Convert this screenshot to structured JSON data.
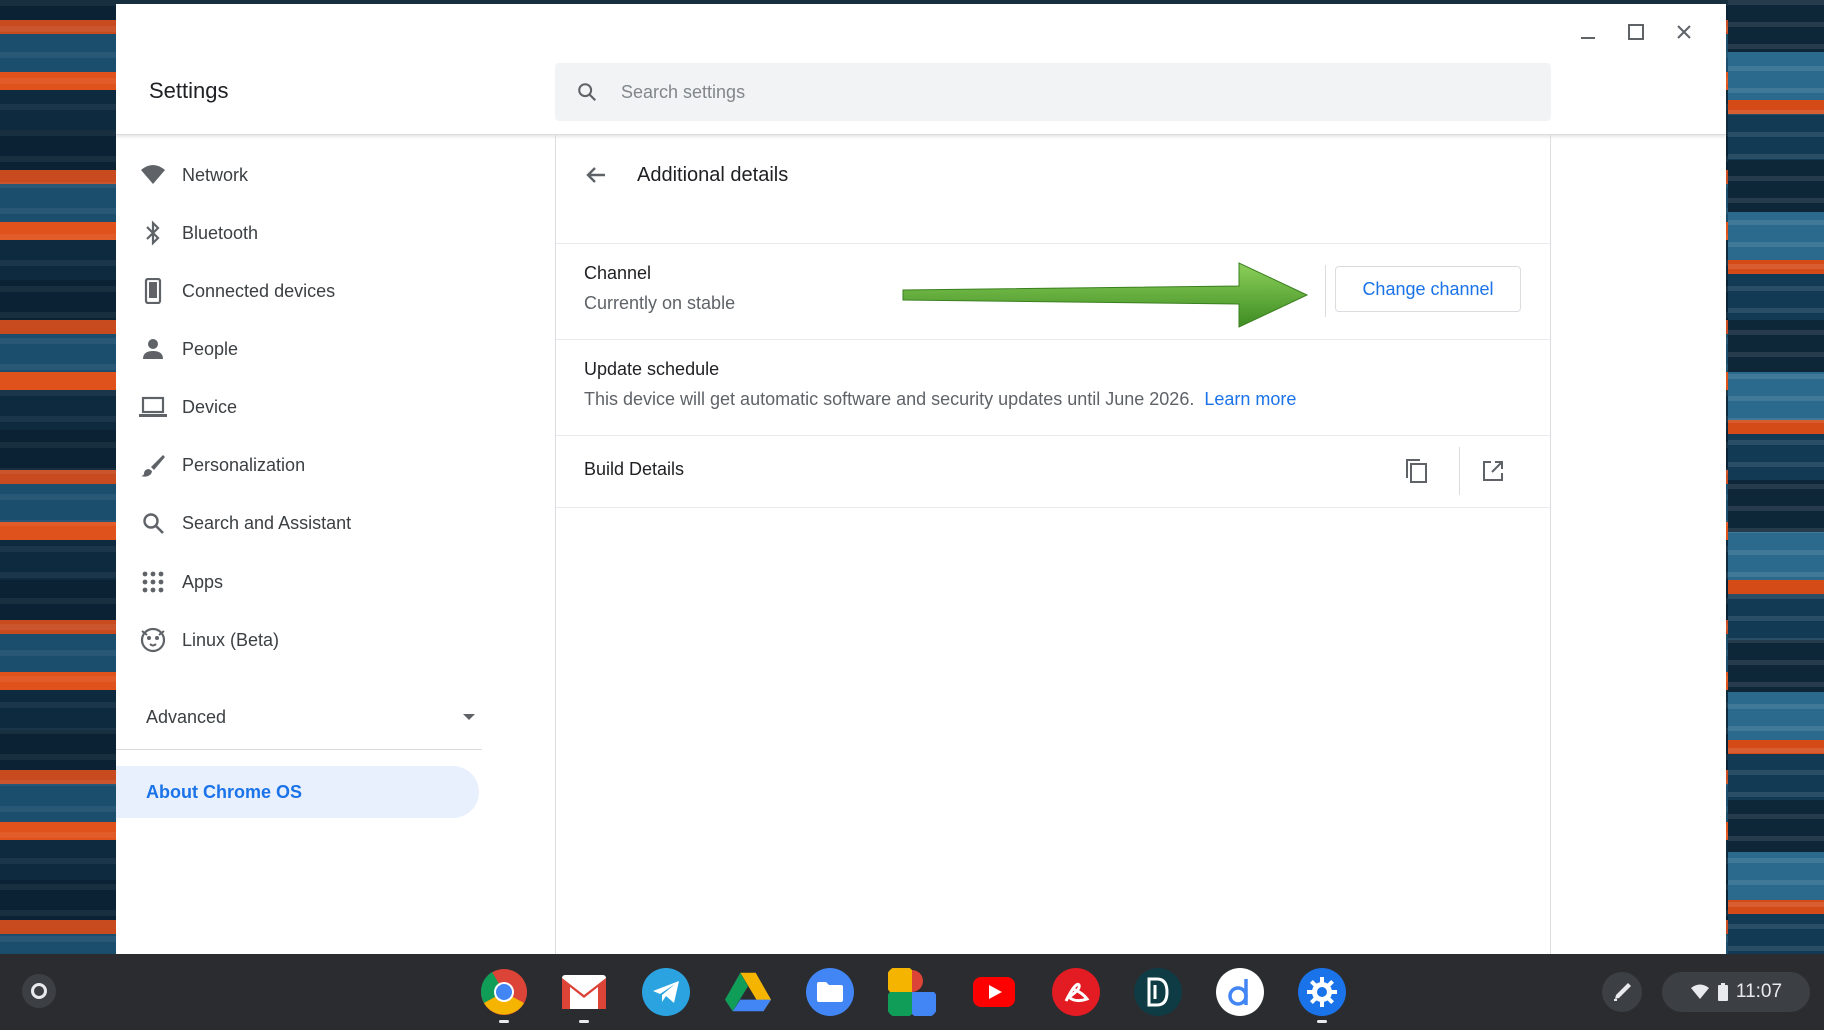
{
  "window": {
    "app_title": "Settings",
    "minimize_icon": "minimize-icon",
    "maximize_icon": "maximize-icon",
    "close_icon": "close-icon"
  },
  "search": {
    "placeholder": "Search settings",
    "icon": "search-icon"
  },
  "sidebar": {
    "items": [
      {
        "label": "Network",
        "icon": "wifi-icon"
      },
      {
        "label": "Bluetooth",
        "icon": "bluetooth-icon"
      },
      {
        "label": "Connected devices",
        "icon": "phone-icon"
      },
      {
        "label": "People",
        "icon": "person-icon"
      },
      {
        "label": "Device",
        "icon": "laptop-icon"
      },
      {
        "label": "Personalization",
        "icon": "brush-icon"
      },
      {
        "label": "Search and Assistant",
        "icon": "search-icon"
      },
      {
        "label": "Apps",
        "icon": "apps-grid-icon"
      },
      {
        "label": "Linux (Beta)",
        "icon": "linux-penguin-icon"
      }
    ],
    "advanced_label": "Advanced",
    "about_label": "About Chrome OS"
  },
  "main": {
    "title": "Additional details",
    "channel": {
      "title": "Channel",
      "subtitle": "Currently on stable",
      "button_label": "Change channel"
    },
    "update_schedule": {
      "title": "Update schedule",
      "text": "This device will get automatic software and security updates until June 2026.",
      "link_label": "Learn more"
    },
    "build_details": {
      "title": "Build Details",
      "copy_icon": "copy-icon",
      "open_icon": "open-in-new-icon"
    }
  },
  "shelf": {
    "apps": [
      "Chrome",
      "Gmail",
      "Telegram",
      "Google Drive",
      "Files",
      "Google Photos",
      "YouTube",
      "Adobe Acrobat",
      "Dashlane",
      "Dictionary",
      "Settings"
    ],
    "time": "11:07"
  },
  "colors": {
    "accent": "#1a73e8",
    "selected_bg": "#e8f0fe",
    "arrow_green": "#5aa832",
    "shelf_bg": "#2a2c30"
  }
}
